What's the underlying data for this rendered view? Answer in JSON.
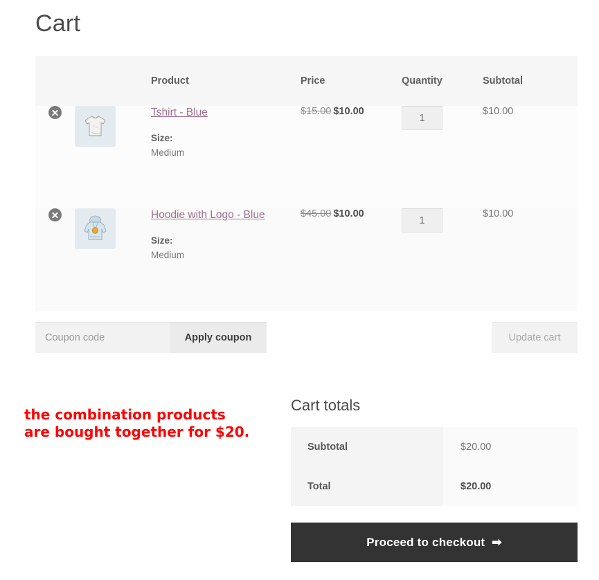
{
  "page": {
    "title": "Cart"
  },
  "cart_table": {
    "headers": {
      "remove": "",
      "thumbnail": "",
      "product": "Product",
      "price": "Price",
      "quantity": "Quantity",
      "subtotal": "Subtotal"
    },
    "rows": [
      {
        "remove_icon": "remove-circle-x-icon",
        "thumbnail_icon": "tshirt-thumbnail",
        "name": "Tshirt - Blue",
        "variation_label": "Size:",
        "variation_value": "Medium",
        "price_original": "$15.00",
        "price_current": "$10.00",
        "quantity": "1",
        "subtotal": "$10.00"
      },
      {
        "remove_icon": "remove-circle-x-icon",
        "thumbnail_icon": "hoodie-thumbnail",
        "name": "Hoodie with Logo - Blue",
        "variation_label": "Size:",
        "variation_value": "Medium",
        "price_original": "$45.00",
        "price_current": "$10.00",
        "quantity": "1",
        "subtotal": "$10.00"
      }
    ]
  },
  "actions": {
    "coupon_placeholder": "Coupon code",
    "coupon_value": "",
    "apply_coupon_label": "Apply coupon",
    "update_cart_label": "Update cart"
  },
  "annotation": {
    "text": "the combination products\nare bought together for $20.",
    "color": "#ff0000"
  },
  "cart_totals": {
    "title": "Cart totals",
    "rows": [
      {
        "label": "Subtotal",
        "value": "$20.00"
      },
      {
        "label": "Total",
        "value": "$20.00"
      }
    ],
    "checkout_label": "Proceed to checkout",
    "checkout_arrow": "➡"
  },
  "colors": {
    "link": "#9e6f91",
    "checkout_bg": "#333333",
    "header_bg": "#f6f6f6",
    "annotation_red": "#ff0000"
  }
}
